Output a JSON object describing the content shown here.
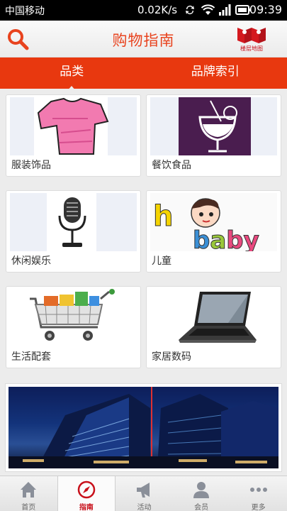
{
  "status_bar": {
    "carrier": "中国移动",
    "net_speed": "0.02K/s",
    "time": "09:39"
  },
  "header": {
    "title": "购物指南",
    "map_label": "楼层地图"
  },
  "tabs": [
    {
      "label": "品类"
    },
    {
      "label": "品牌索引"
    }
  ],
  "categories": [
    {
      "label": "服装饰品",
      "icon": "tshirt-icon"
    },
    {
      "label": "餐饮食品",
      "icon": "drink-icon"
    },
    {
      "label": "休闲娱乐",
      "icon": "microphone-icon"
    },
    {
      "label": "儿童",
      "icon": "baby-icon",
      "image_text": "baby"
    },
    {
      "label": "生活配套",
      "icon": "cart-icon"
    },
    {
      "label": "家居数码",
      "icon": "laptop-icon"
    }
  ],
  "bottom_nav": [
    {
      "label": "首页",
      "icon": "home-icon"
    },
    {
      "label": "指南",
      "icon": "compass-icon"
    },
    {
      "label": "活动",
      "icon": "megaphone-icon"
    },
    {
      "label": "会员",
      "icon": "user-icon"
    },
    {
      "label": "更多",
      "icon": "more-icon"
    }
  ],
  "colors": {
    "accent": "#e8380f",
    "title_red": "#e8431e"
  }
}
